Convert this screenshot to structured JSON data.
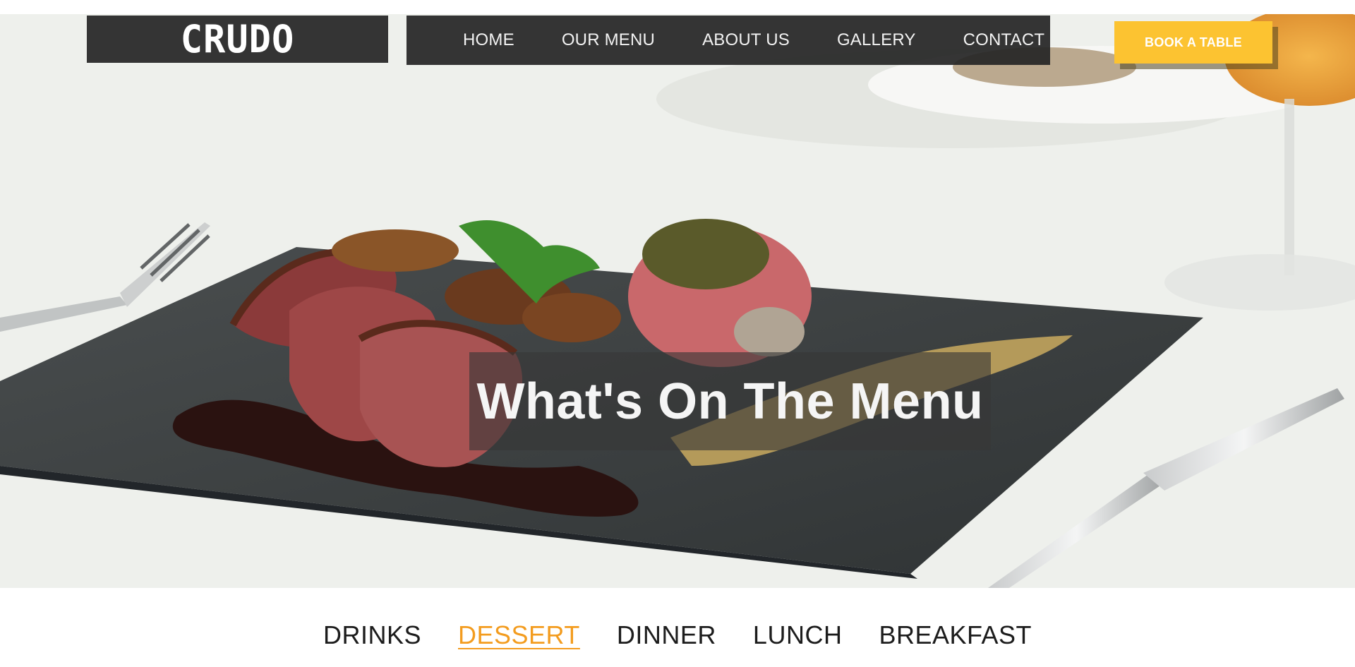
{
  "header": {
    "logo": "CRUDO",
    "nav": [
      "HOME",
      "OUR MENU",
      "ABOUT US",
      "GALLERY",
      "CONTACT"
    ],
    "book_button": "BOOK A TABLE"
  },
  "hero": {
    "headline": "What's On The Menu",
    "image_subject": "sliced-steak-on-slate-plate"
  },
  "menu_tabs": {
    "items": [
      "DRINKS",
      "DESSERT",
      "DINNER",
      "LUNCH",
      "BREAKFAST"
    ],
    "active": "DESSERT"
  },
  "colors": {
    "accent": "#fcc331",
    "active_tab": "#f39c1f",
    "nav_bg": "#262626",
    "slate": "#3b3f40"
  }
}
